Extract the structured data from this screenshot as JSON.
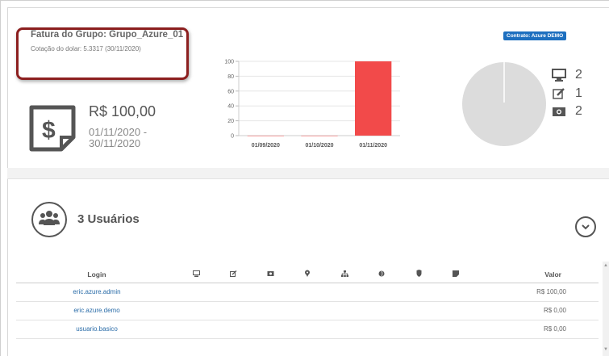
{
  "invoice": {
    "group_title": "Fatura do Grupo: Grupo_Azure_01",
    "exchange_rate": "Cotação do dolar: 5.3317 (30/11/2020)",
    "amount": "R$ 100,00",
    "period": "01/11/2020 - 30/11/2020"
  },
  "contract": {
    "badge": "Contrato: Azure DEMO"
  },
  "chart_data": {
    "type": "bar",
    "categories": [
      "01/09/2020",
      "01/10/2020",
      "01/11/2020"
    ],
    "values": [
      0,
      0,
      100
    ],
    "ylim": [
      0,
      100
    ],
    "yticks": [
      0,
      20,
      40,
      60,
      80,
      100
    ],
    "grid": true,
    "bar_color": "#f24a4a"
  },
  "pie": {
    "color": "#dcdcdc",
    "divider_color": "#ffffff"
  },
  "stats": [
    {
      "icon": "monitor-icon",
      "value": "2"
    },
    {
      "icon": "edit-icon",
      "value": "1"
    },
    {
      "icon": "camera-icon",
      "value": "2"
    }
  ],
  "users": {
    "count_label": "3 Usuários"
  },
  "table": {
    "columns": {
      "login": "Login",
      "valor": "Valor",
      "icon_columns": [
        "monitor-icon",
        "edit-icon",
        "image-icon",
        "pin-icon",
        "sitemap-icon",
        "globe-icon",
        "shield-icon",
        "note-icon"
      ]
    },
    "rows": [
      {
        "login": "eric.azure.admin",
        "valor": "R$ 100,00"
      },
      {
        "login": "eric.azure.demo",
        "valor": "R$ 0,00"
      },
      {
        "login": "usuario.basico",
        "valor": "R$ 0,00"
      }
    ]
  },
  "colors": {
    "accent": "#1d6fbf",
    "link": "#2a6ca8",
    "highlight_border": "#8c1f1f"
  }
}
